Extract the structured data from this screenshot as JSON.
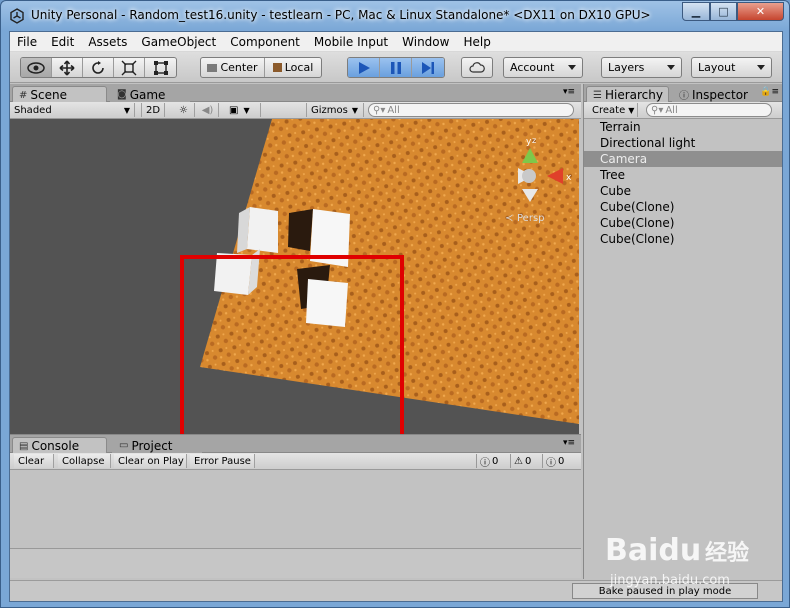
{
  "window": {
    "title": "Unity Personal - Random_test16.unity - testlearn - PC, Mac & Linux Standalone* <DX11 on DX10 GPU>",
    "minimize_glyph": "▁",
    "maximize_glyph": "□",
    "close_glyph": "✕"
  },
  "menu": [
    "File",
    "Edit",
    "Assets",
    "GameObject",
    "Component",
    "Mobile Input",
    "Window",
    "Help"
  ],
  "toolbar": {
    "transform_tools": [
      "hand-eye-icon",
      "move-icon",
      "rotate-icon",
      "scale-icon",
      "rect-icon"
    ],
    "pivot_label": "Center",
    "space_label": "Local",
    "play_controls": [
      "play-icon",
      "pause-icon",
      "step-icon"
    ],
    "cloud_icon": "cloud-icon",
    "account_label": "Account",
    "layers_label": "Layers",
    "layout_label": "Layout"
  },
  "scene_panel": {
    "tabs": [
      {
        "label": "Scene",
        "icon": "#"
      },
      {
        "label": "Game",
        "icon": "◙"
      }
    ],
    "shading_mode": "Shaded",
    "mode_2d": "2D",
    "gizmos_label": "Gizmos",
    "search_placeholder": "All",
    "persp_label": "Persp",
    "gizmo_y": "y",
    "gizmo_z": "z",
    "gizmo_x": "x",
    "highlight_color": "#e00000"
  },
  "hierarchy_panel": {
    "tabs": [
      {
        "label": "Hierarchy",
        "icon": "☰"
      },
      {
        "label": "Inspector",
        "icon": "ⓘ"
      }
    ],
    "create_label": "Create",
    "search_placeholder": "All",
    "items": [
      "Terrain",
      "Directional light",
      "Camera",
      "Tree",
      "Cube",
      "Cube(Clone)",
      "Cube(Clone)",
      "Cube(Clone)"
    ],
    "selected_index": 2
  },
  "console_panel": {
    "tabs": [
      {
        "label": "Console",
        "icon": "▤"
      },
      {
        "label": "Project",
        "icon": "▭"
      }
    ],
    "buttons": [
      "Clear",
      "Collapse",
      "Clear on Play",
      "Error Pause"
    ],
    "info_count": "0",
    "warning_count": "0",
    "error_count": "0"
  },
  "status": {
    "bake_message": "Bake paused in play mode"
  },
  "watermark": {
    "brand": "Baidu",
    "brand_cn": "经验",
    "url": "jingyan.baidu.com"
  }
}
